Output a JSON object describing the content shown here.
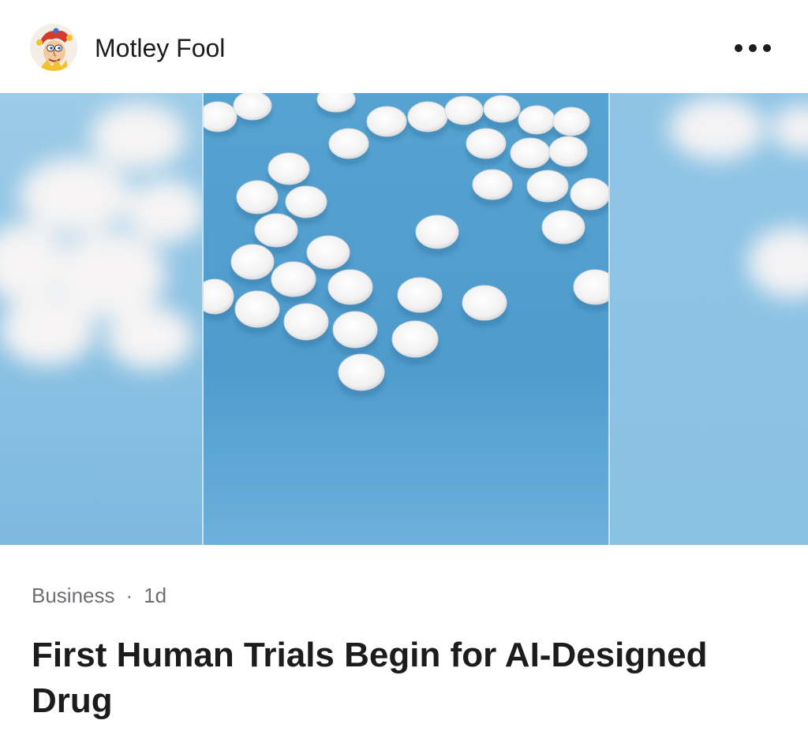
{
  "header": {
    "publisher_name": "Motley Fool",
    "avatar_icon": "jester-logo",
    "more_icon": "ellipsis-icon"
  },
  "article": {
    "category": "Business",
    "separator": "·",
    "age": "1d",
    "headline": "First Human Trials Begin for AI-Designed Drug"
  },
  "hero_image": {
    "subject": "white pills on blue background"
  },
  "colors": {
    "background": "#ffffff",
    "text_primary": "#1c1c1e",
    "text_secondary": "#6e6e73",
    "hero_blue": "#4f9fd0",
    "pill": "#f7f7f7"
  }
}
